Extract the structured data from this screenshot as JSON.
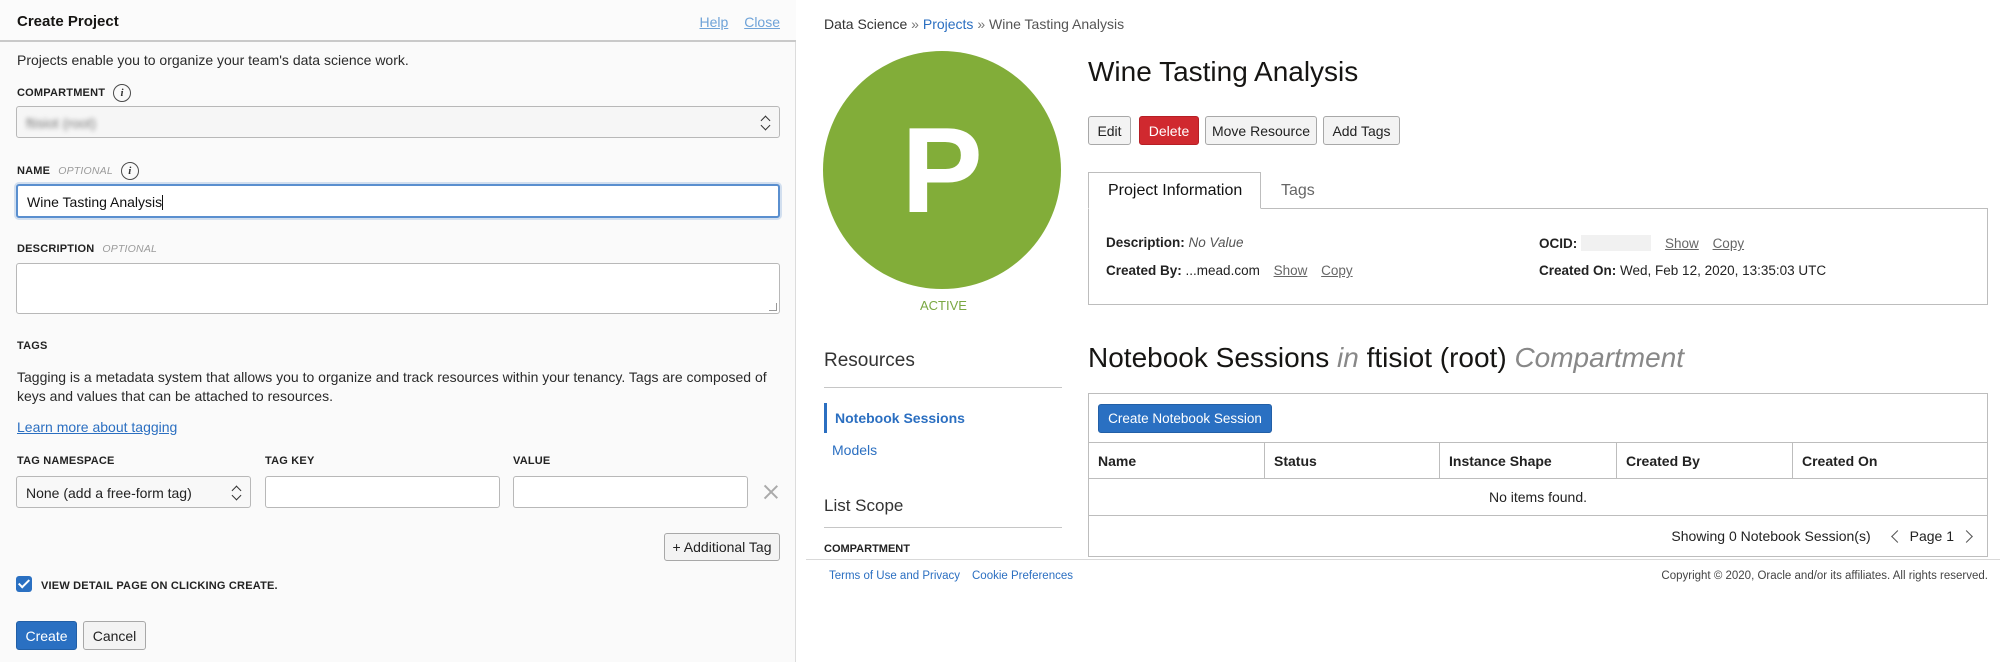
{
  "dialog": {
    "title": "Create Project",
    "help_label": "Help",
    "close_label": "Close",
    "intro": "Projects enable you to organize your team's data science work.",
    "compartment": {
      "label": "COMPARTMENT",
      "value": "ftisiot (root)"
    },
    "name": {
      "label": "NAME",
      "optional": "OPTIONAL",
      "value": "Wine Tasting Analysis"
    },
    "description": {
      "label": "DESCRIPTION",
      "optional": "OPTIONAL",
      "value": ""
    },
    "tags": {
      "heading": "TAGS",
      "text": "Tagging is a metadata system that allows you to organize and track resources within your tenancy. Tags are composed of keys and values that can be attached to resources.",
      "learn_more": "Learn more about tagging",
      "namespace_label": "TAG NAMESPACE",
      "namespace_value": "None (add a free-form tag)",
      "key_label": "TAG KEY",
      "value_label": "VALUE",
      "additional_label": "+ Additional Tag"
    },
    "view_detail_label": "VIEW DETAIL PAGE ON CLICKING CREATE.",
    "create_label": "Create",
    "cancel_label": "Cancel"
  },
  "page": {
    "breadcrumb": {
      "root": "Data Science",
      "projects": "Projects",
      "current": "Wine Tasting Analysis",
      "separator": "»"
    },
    "avatar_letter": "P",
    "avatar_color": "#82ad39",
    "status": "ACTIVE",
    "title": "Wine Tasting Analysis",
    "actions": {
      "edit": "Edit",
      "delete": "Delete",
      "move": "Move Resource",
      "add_tags": "Add Tags"
    },
    "tabs": {
      "info": "Project Information",
      "tags": "Tags"
    },
    "info": {
      "description_label": "Description:",
      "description_value": "No Value",
      "created_by_label": "Created By:",
      "created_by_value": "...mead.com",
      "ocid_label": "OCID:",
      "created_on_label": "Created On:",
      "created_on_value": "Wed, Feb 12, 2020, 13:35:03 UTC",
      "show": "Show",
      "copy": "Copy"
    },
    "resources": {
      "title": "Resources",
      "items": [
        "Notebook Sessions",
        "Models"
      ]
    },
    "scope": {
      "title": "List Scope",
      "compartment_label": "COMPARTMENT"
    },
    "section": {
      "title": "Notebook Sessions",
      "in": "in",
      "compartment_name": "ftisiot (root)",
      "compartment_word": "Compartment"
    },
    "create_session_label": "Create Notebook Session",
    "table": {
      "columns": [
        "Name",
        "Status",
        "Instance Shape",
        "Created By",
        "Created On"
      ],
      "empty": "No items found.",
      "showing": "Showing 0 Notebook Session(s)",
      "page": "Page 1"
    },
    "footer": {
      "terms": "Terms of Use and Privacy",
      "cookies": "Cookie Preferences",
      "copyright": "Copyright © 2020, Oracle and/or its affiliates. All rights reserved."
    }
  }
}
